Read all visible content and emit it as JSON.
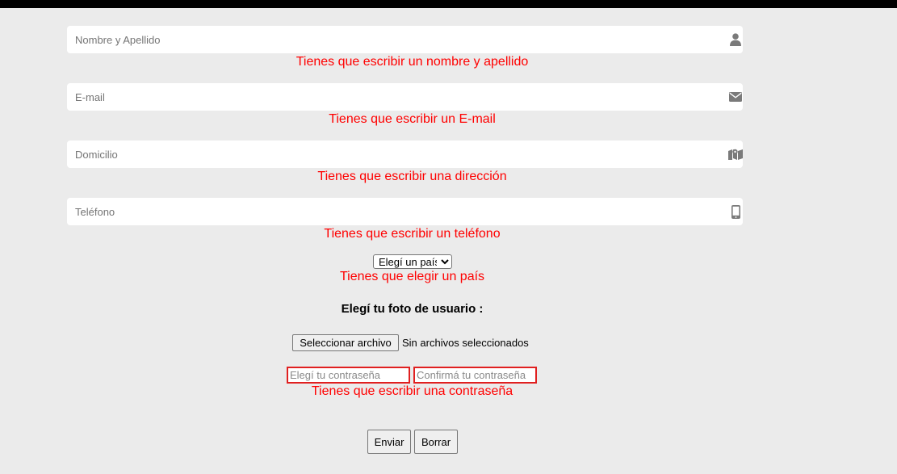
{
  "form": {
    "name_placeholder": "Nombre y Apellido",
    "name_error": "Tienes que escribir un nombre y apellido",
    "email_placeholder": "E-mail",
    "email_error": "Tienes que escribir un E-mail",
    "address_placeholder": "Domicilio",
    "address_error": "Tienes que escribir una dirección",
    "phone_placeholder": "Teléfono",
    "phone_error": "Tienes que escribir un teléfono",
    "country_selected": "Elegí un país",
    "country_error": "Tienes que elegir un país",
    "photo_title": "Elegí tu foto de usuario :",
    "file_button": "Seleccionar archivo",
    "file_status": "Sin archivos seleccionados",
    "password_placeholder": "Elegí tu contraseña",
    "confirm_placeholder": "Confirmá tu contraseña",
    "password_error": "Tienes que escribir una contraseña",
    "submit_label": "Enviar",
    "reset_label": "Borrar"
  },
  "icons": {
    "name": "user-icon",
    "email": "envelope-icon",
    "address": "map-icon",
    "phone": "mobile-phone-icon"
  },
  "colors": {
    "error": "#ff0000",
    "background": "#ebebeb",
    "icon": "#7a7a7a"
  }
}
